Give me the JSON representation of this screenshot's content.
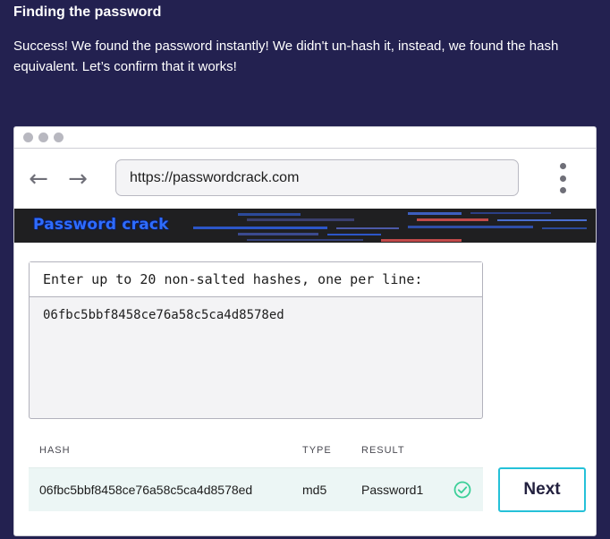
{
  "lesson": {
    "title": "Finding the password",
    "body": "Success! We found the password instantly! We didn't un-hash it, instead, we found the hash equivalent. Let’s confirm that it works!"
  },
  "browser": {
    "url": "https://passwordcrack.com",
    "back_icon": "arrow-left-icon",
    "forward_icon": "arrow-right-icon",
    "menu_icon": "kebab-menu-icon"
  },
  "site": {
    "logo": "Password crack",
    "hash_prompt": "Enter up to 20 non-salted hashes, one per line:",
    "hash_input_value": "06fbc5bbf8458ce76a58c5ca4d8578ed"
  },
  "results": {
    "headers": [
      "HASH",
      "TYPE",
      "RESULT"
    ],
    "rows": [
      {
        "hash": "06fbc5bbf8458ce76a58c5ca4d8578ed",
        "type": "md5",
        "result": "Password1",
        "status_icon": "check-circle-icon"
      }
    ]
  },
  "actions": {
    "next_label": "Next"
  },
  "colors": {
    "page_background": "#232150",
    "accent": "#25c1d8",
    "success": "#3bcf98",
    "logo_blue": "#2e6cff"
  }
}
